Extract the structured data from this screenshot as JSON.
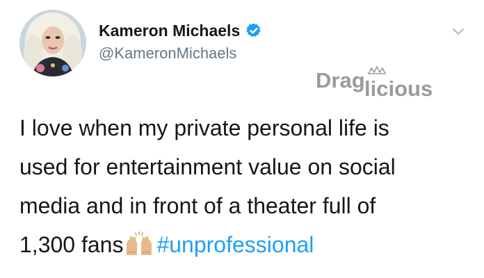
{
  "author": {
    "display_name": "Kameron Michaels",
    "handle": "@KameronMichaels",
    "verified": true
  },
  "watermark": {
    "text_part1": "Drag",
    "text_part2": "licious"
  },
  "tweet": {
    "lines": [
      "I love when my private personal life is",
      "used for entertainment value on social",
      "media and in front of a theater full of"
    ],
    "last_line_text": "1,300 fans",
    "hashtag": "#unprofessional"
  },
  "colors": {
    "text": "#14171a",
    "secondary": "#657786",
    "link": "#1da1f2",
    "verified_badge": "#1da1f2",
    "chevron": "#aab8c2",
    "watermark": "#9b9b9b"
  },
  "icons": {
    "verified": "verified-badge-icon",
    "chevron": "chevron-down-icon",
    "emoji": "raising-hands-emoji-icon"
  }
}
